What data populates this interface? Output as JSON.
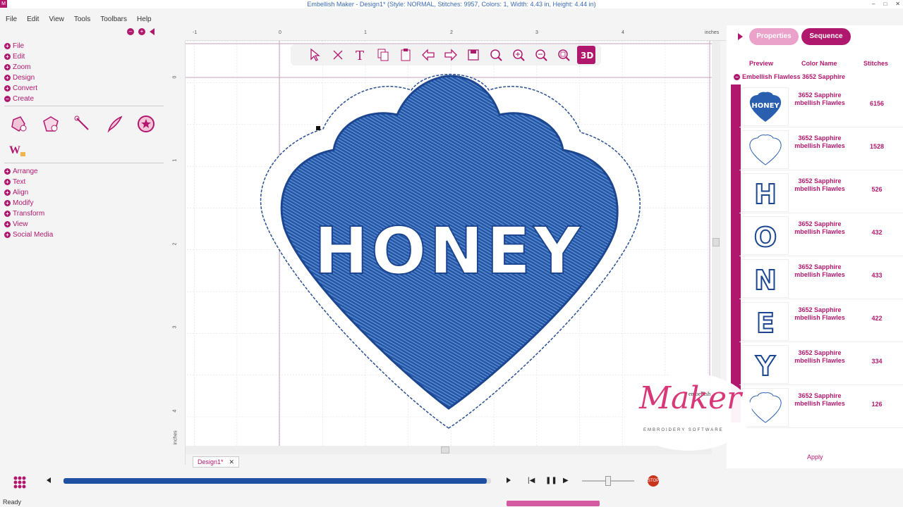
{
  "window": {
    "title": "Embellish Maker - Design1* (Style: NORMAL, Stitches: 9957, Colors: 1, Width: 4.43 in, Height: 4.44 in)",
    "app_icon": "M",
    "min": "–",
    "max": "□",
    "close": "✕"
  },
  "menu": [
    "File",
    "Edit",
    "View",
    "Tools",
    "Toolbars",
    "Help"
  ],
  "left_sections_top": [
    "File",
    "Edit",
    "Zoom",
    "Design",
    "Convert",
    "Create"
  ],
  "left_sections_bottom": [
    "Arrange",
    "Text",
    "Align",
    "Modify",
    "Transform",
    "View",
    "Social Media"
  ],
  "ruler": {
    "units": "inches",
    "h_ticks": [
      "-1",
      "0",
      "1",
      "2",
      "3",
      "4"
    ],
    "v_ticks": [
      "0",
      "1",
      "2",
      "3",
      "4"
    ],
    "v_units": "inches"
  },
  "design": {
    "text": "HONEY",
    "fill_color": "#2a5fb0",
    "outline_color": "#2b4f93"
  },
  "tabs": {
    "properties": "Properties",
    "sequence": "Sequence"
  },
  "columns": {
    "preview": "Preview",
    "color_name": "Color Name",
    "stitches": "Stitches"
  },
  "group_label": "Embellish Flawless 3652 Sapphire",
  "sequence": [
    {
      "preview": "shield-honey",
      "color": "3652 Sapphire mbellish Flawles",
      "stitches": "6156"
    },
    {
      "preview": "outline-shape",
      "color": "3652 Sapphire mbellish Flawles",
      "stitches": "1528"
    },
    {
      "preview": "H",
      "color": "3652 Sapphire mbellish Flawles",
      "stitches": "526"
    },
    {
      "preview": "O",
      "color": "3652 Sapphire mbellish Flawles",
      "stitches": "432"
    },
    {
      "preview": "N",
      "color": "3652 Sapphire mbellish Flawles",
      "stitches": "433"
    },
    {
      "preview": "E",
      "color": "3652 Sapphire mbellish Flawles",
      "stitches": "422"
    },
    {
      "preview": "Y",
      "color": "3652 Sapphire mbellish Flawles",
      "stitches": "334"
    },
    {
      "preview": "outline-shape",
      "color": "3652 Sapphire mbellish Flawles",
      "stitches": "126"
    }
  ],
  "apply_label": "Apply",
  "doc_tab": "Design1*",
  "status": "Ready",
  "playback": {
    "progress": 0.99,
    "speed": 0.5
  },
  "logo": {
    "main": "Maker",
    "top": "embellish",
    "sub": "EMBROIDERY SOFTWARE"
  },
  "colors": {
    "accent": "#b0186e",
    "thread": "#2a5fb0",
    "progress": "#1f4fa0"
  }
}
